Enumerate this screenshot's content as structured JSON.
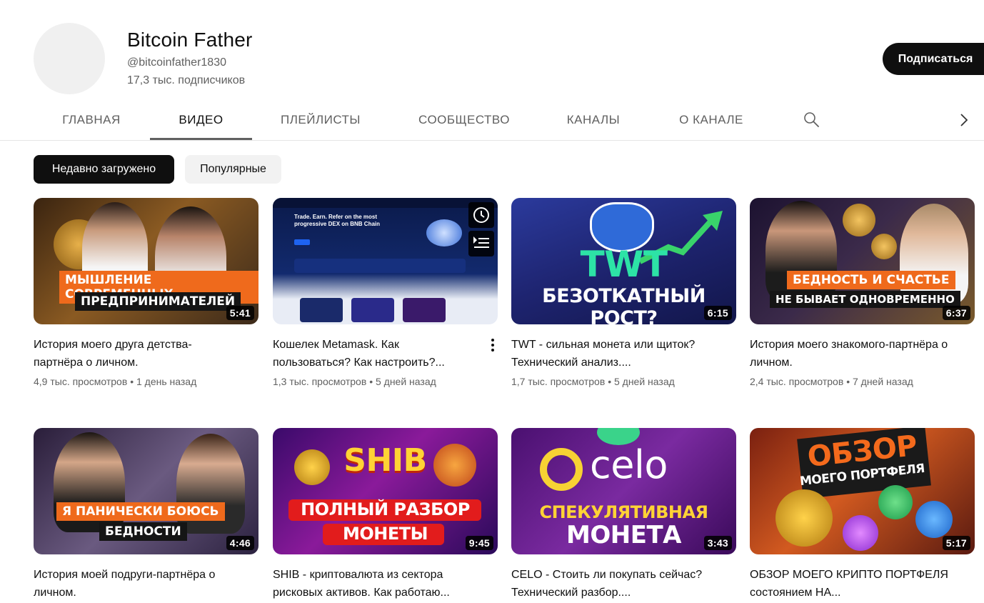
{
  "channel": {
    "title": "Bitcoin Father",
    "handle": "@bitcoinfather1830",
    "subscribers": "17,3 тыс. подписчиков",
    "subscribe_label": "Подписаться"
  },
  "tabs": [
    {
      "label": "ГЛАВНАЯ",
      "active": false
    },
    {
      "label": "ВИДЕО",
      "active": true
    },
    {
      "label": "ПЛЕЙЛИСТЫ",
      "active": false
    },
    {
      "label": "СООБЩЕСТВО",
      "active": false
    },
    {
      "label": "КАНАЛЫ",
      "active": false
    },
    {
      "label": "О КАНАЛЕ",
      "active": false
    }
  ],
  "chips": [
    {
      "label": "Недавно загружено",
      "active": true
    },
    {
      "label": "Популярные",
      "active": false
    }
  ],
  "videos": [
    {
      "title": "История моего друга детства-партнёра о личном.",
      "views": "4,9 тыс. просмотров",
      "age": "1 день назад",
      "duration": "5:41",
      "thumb_text": [
        "МЫШЛЕНИЕ СОВРЕМЕННЫХ",
        "ПРЕДПРИНИМАТЕЛЕЙ"
      ]
    },
    {
      "title": "Кошелек Metamask. Как пользоваться? Как настроить?...",
      "views": "1,3 тыс. просмотров",
      "age": "5 дней назад",
      "duration": "",
      "thumb_text": [
        "Trade. Earn. Refer on the most",
        "progressive DEX on BNB Chain"
      ]
    },
    {
      "title": "TWT - сильная монета или щиток? Технический анализ....",
      "views": "1,7 тыс. просмотров",
      "age": "5 дней назад",
      "duration": "6:15",
      "thumb_text": [
        "TWT",
        "БЕЗОТКАТНЫЙ РОСТ?"
      ]
    },
    {
      "title": "История моего знакомого-партнёра о личном.",
      "views": "2,4 тыс. просмотров",
      "age": "7 дней назад",
      "duration": "6:37",
      "thumb_text": [
        "БЕДНОСТЬ И СЧАСТЬЕ",
        "НЕ БЫВАЕТ ОДНОВРЕМЕННО"
      ]
    },
    {
      "title": "История моей подруги-партнёра о личном.",
      "views": "",
      "age": "",
      "duration": "4:46",
      "thumb_text": [
        "Я ПАНИЧЕСКИ БОЮСЬ",
        "БЕДНОСТИ"
      ]
    },
    {
      "title": "SHIB - криптовалюта из сектора рисковых активов. Как работаю...",
      "views": "",
      "age": "",
      "duration": "9:45",
      "thumb_text": [
        "SHIB",
        "ПОЛНЫЙ РАЗБОР",
        "МОНЕТЫ"
      ]
    },
    {
      "title": "CELO - Стоить ли покупать сейчас? Технический разбор....",
      "views": "",
      "age": "",
      "duration": "3:43",
      "thumb_text": [
        "celo",
        "СПЕКУЛЯТИВНАЯ",
        "МОНЕТА"
      ]
    },
    {
      "title": "ОБЗОР МОЕГО КРИПТО ПОРТФЕЛЯ состоянием НА...",
      "views": "",
      "age": "",
      "duration": "5:17",
      "thumb_text": [
        "ОБЗОР",
        "МОЕГО ПОРТФЕЛЯ"
      ]
    }
  ],
  "meta_separator": "•",
  "icons": [
    "search-icon",
    "chevron-right-icon",
    "more-vert-icon",
    "watch-later-icon",
    "add-to-queue-icon"
  ]
}
